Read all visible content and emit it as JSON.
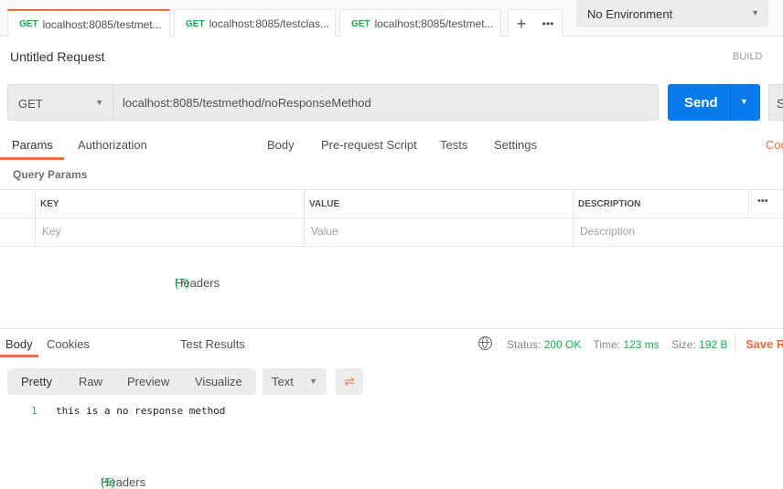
{
  "tabs": [
    {
      "method": "GET",
      "label": "localhost:8085/testmet..."
    },
    {
      "method": "GET",
      "label": "localhost:8085/testclas..."
    },
    {
      "method": "GET",
      "label": "localhost:8085/testmet..."
    }
  ],
  "environment": "No Environment",
  "request_title": "Untitled Request",
  "build_label": "BUILD",
  "method": "GET",
  "url": "localhost:8085/testmethod/noResponseMethod",
  "send_label": "Send",
  "save_partial": "S",
  "request_tabs": {
    "params": "Params",
    "authorization": "Authorization",
    "headers": "Headers",
    "headers_count": "(7)",
    "body": "Body",
    "prerequest": "Pre-request Script",
    "tests": "Tests",
    "settings": "Settings",
    "code": "Code"
  },
  "query_params_label": "Query Params",
  "table": {
    "key": "KEY",
    "value": "VALUE",
    "description": "DESCRIPTION",
    "key_ph": "Key",
    "value_ph": "Value",
    "description_ph": "Description"
  },
  "response_tabs": {
    "body": "Body",
    "cookies": "Cookies",
    "headers": "Headers",
    "headers_count": "(5)",
    "test_results": "Test Results"
  },
  "status": {
    "status_label": "Status:",
    "status_value": "200 OK",
    "time_label": "Time:",
    "time_value": "123 ms",
    "size_label": "Size:",
    "size_value": "192 B",
    "save": "Save Re"
  },
  "view_modes": [
    "Pretty",
    "Raw",
    "Preview",
    "Visualize"
  ],
  "format": "Text",
  "response_lines": [
    {
      "num": "1",
      "text": "this is a no response method"
    }
  ],
  "colors": {
    "accent": "#f26b3a",
    "send": "#097bed",
    "green": "#0cb04a"
  }
}
